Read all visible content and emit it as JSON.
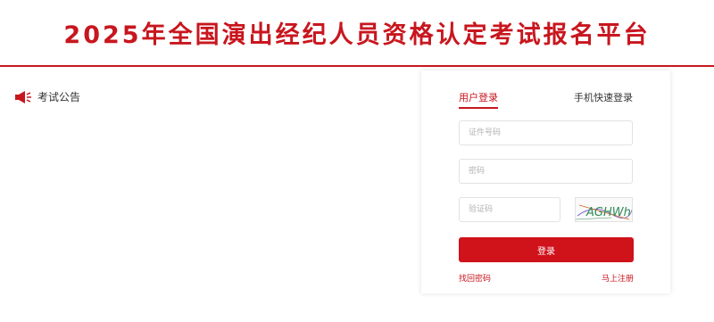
{
  "header": {
    "title": "2025年全国演出经纪人员资格认定考试报名平台"
  },
  "notice": {
    "title": "考试公告",
    "icon": "megaphone-icon"
  },
  "login": {
    "tabs": [
      {
        "label": "用户登录",
        "active": true
      },
      {
        "label": "手机快速登录",
        "active": false
      }
    ],
    "id_placeholder": "证件号码",
    "password_placeholder": "密码",
    "captcha_placeholder": "验证码",
    "captcha_text": "AGHWh",
    "submit_label": "登录",
    "forgot_label": "找回密码",
    "register_label": "马上注册"
  },
  "colors": {
    "brand": "#c8161e",
    "button": "#d0121b"
  }
}
